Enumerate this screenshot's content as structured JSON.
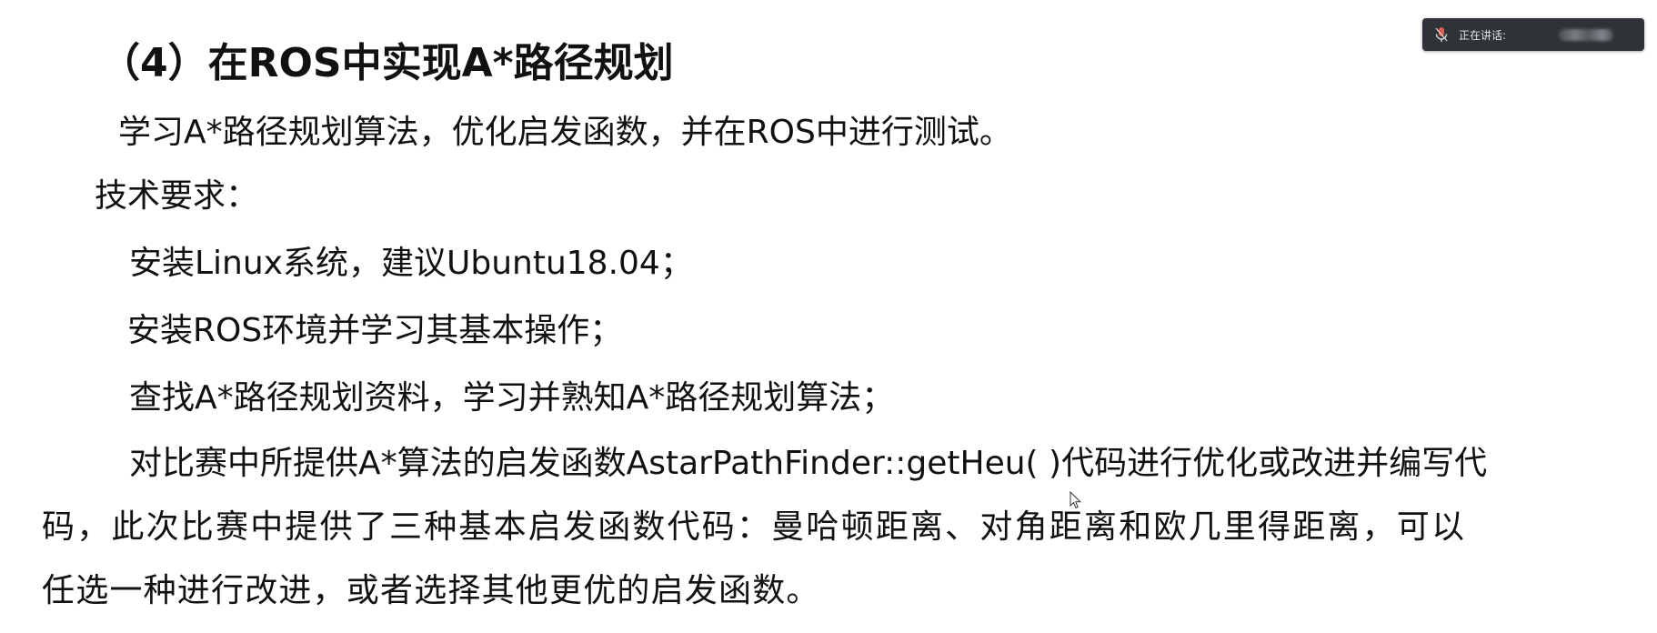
{
  "slide": {
    "heading": "（4）在ROS中实现A*路径规划",
    "intro": "学习A*路径规划算法，优化启发函数，并在ROS中进行测试。",
    "requirements_heading": "技术要求：",
    "items": [
      "安装Linux系统，建议Ubuntu18.04；",
      "安装ROS环境并学习其基本操作；",
      "查找A*路径规划资料，学习并熟知A*路径规划算法；",
      "对比赛中所提供A*算法的启发函数AstarPathFinder::getHeu( )代码进行优化或改进并编写代",
      "码，此次比赛中提供了三种基本启发函数代码：曼哈顿距离、对角距离和欧几里得距离，可以",
      "任选一种进行改进，或者选择其他更优的启发函数。"
    ]
  },
  "overlay": {
    "speaking_label": "正在讲话:",
    "mic_icon": "microphone-icon"
  },
  "colors": {
    "text": "#111111",
    "background": "#ffffff",
    "overlay_bg": "#2f3237",
    "mic_red": "#e05a4f"
  }
}
